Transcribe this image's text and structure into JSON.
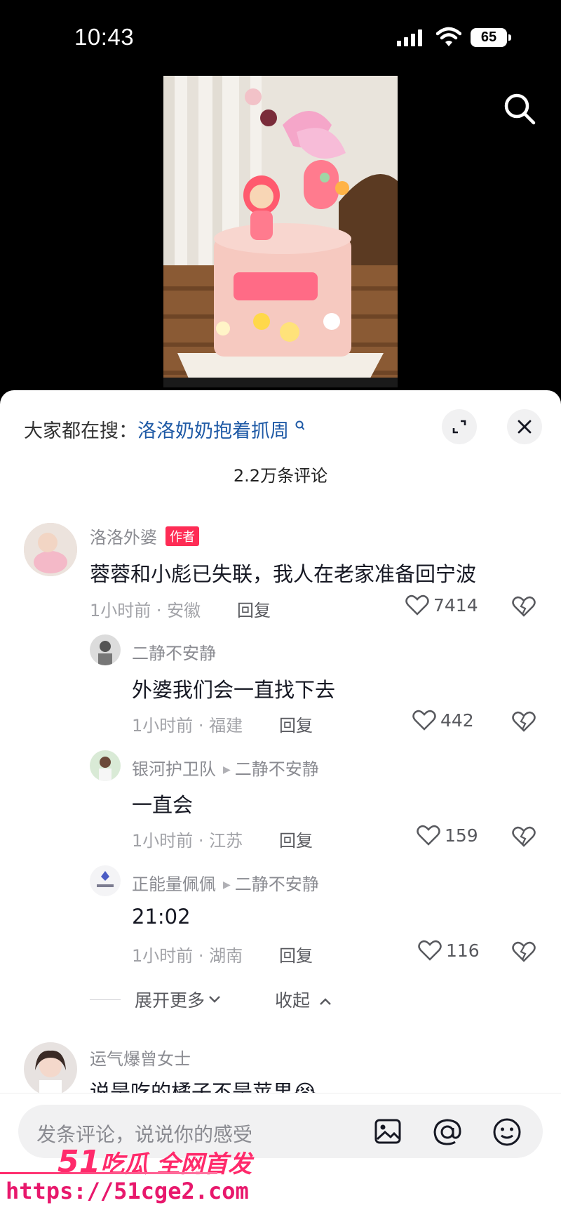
{
  "status_bar": {
    "time": "10:43",
    "battery": "65"
  },
  "hot_search": {
    "prefix": "大家都在搜：",
    "keyword": "洛洛奶奶抱着抓周"
  },
  "comment_count": "2.2万条评论",
  "comments": [
    {
      "user": "洛洛外婆",
      "tag": "作者",
      "text": "蓉蓉和小彪已失联，我人在老家准备回宁波",
      "meta": "1小时前 · 安徽",
      "reply_label": "回复",
      "likes": "7414"
    },
    {
      "user": "运气爆曾女士",
      "text": "说是吃的橘子不是苹果😭"
    }
  ],
  "replies": [
    {
      "user": "二静不安静",
      "text": "外婆我们会一直找下去",
      "meta": "1小时前 · 福建",
      "reply_label": "回复",
      "likes": "442"
    },
    {
      "user": "银河护卫队",
      "reply_to": "二静不安静",
      "text": "一直会",
      "meta": "1小时前 · 江苏",
      "reply_label": "回复",
      "likes": "159"
    },
    {
      "user": "正能量佩佩",
      "reply_to": "二静不安静",
      "text": "21:02",
      "meta": "1小时前 · 湖南",
      "reply_label": "回复",
      "likes": "116"
    }
  ],
  "thread_controls": {
    "expand": "展开更多",
    "collapse": "收起"
  },
  "input": {
    "placeholder": "发条评论，说说你的感受"
  },
  "watermark": {
    "brand_num": "51",
    "brand_text": "吃瓜 全网首发",
    "url": "https://51cge2.com"
  },
  "colors": {
    "accent": "#fe2c55",
    "keyword": "#1f5aa6",
    "watermark": "#ff2a6b"
  }
}
